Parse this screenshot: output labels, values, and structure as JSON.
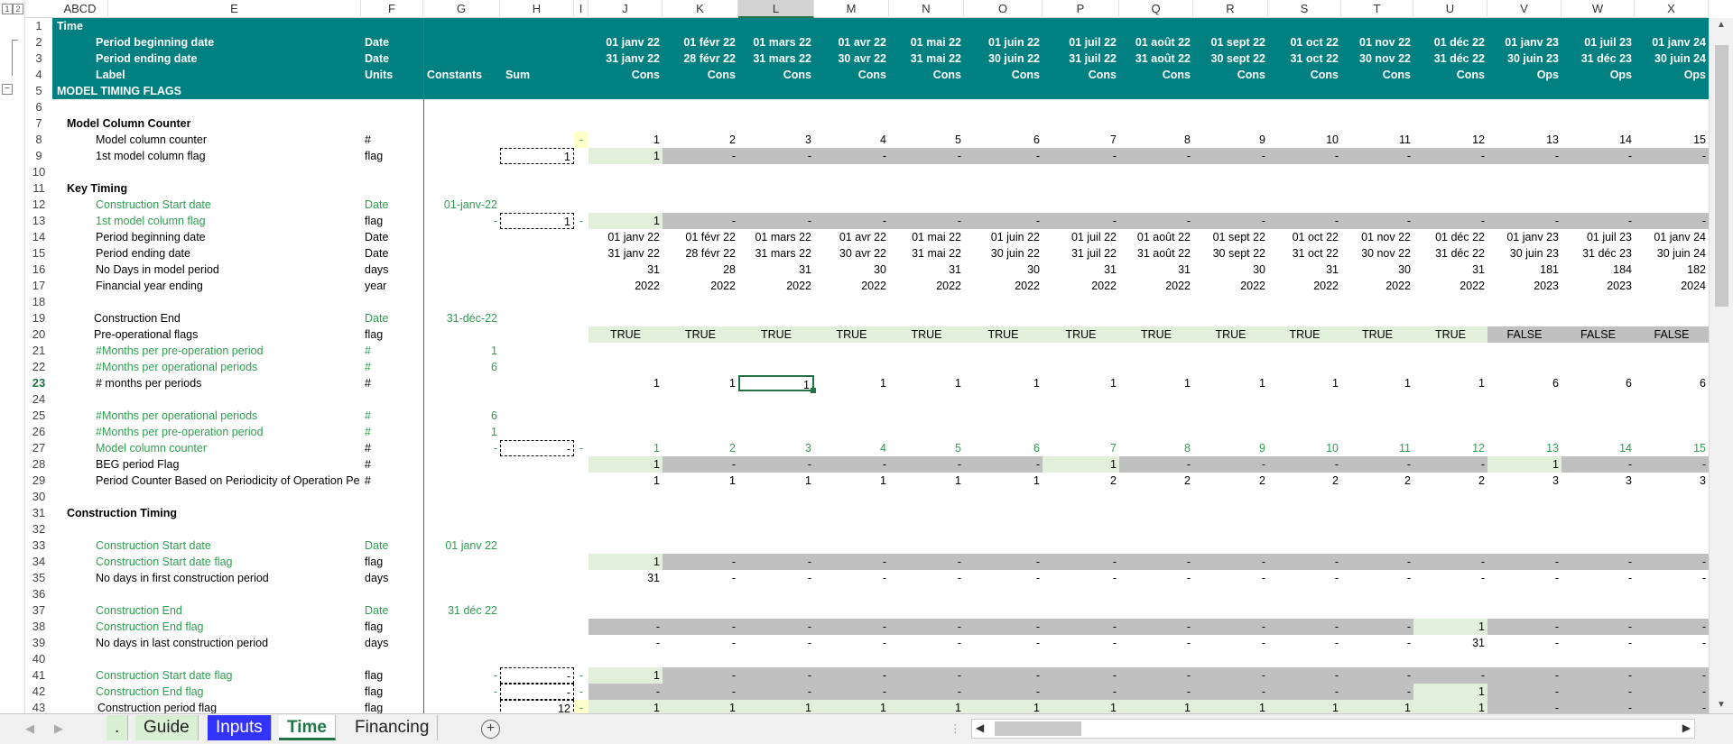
{
  "columns": [
    "ABCD",
    "E",
    "F",
    "G",
    "H",
    "I",
    "J",
    "K",
    "L",
    "M",
    "N",
    "O",
    "P",
    "Q",
    "R",
    "S",
    "T",
    "U",
    "V",
    "W",
    "X"
  ],
  "selected_column": "L",
  "outline_levels": [
    "1",
    "2"
  ],
  "header_rows": [
    {
      "row": "1",
      "label": "Time"
    },
    {
      "row": "2",
      "label": "Period beginning date",
      "unit": "Date",
      "dates": [
        "01 janv 22",
        "01 févr 22",
        "01 mars 22",
        "01 avr 22",
        "01 mai 22",
        "01 juin 22",
        "01 juil 22",
        "01 août 22",
        "01 sept 22",
        "01 oct 22",
        "01 nov 22",
        "01 déc 22",
        "01 janv 23",
        "01 juil 23",
        "01 janv 24"
      ]
    },
    {
      "row": "3",
      "label": "Period ending date",
      "unit": "Date",
      "dates": [
        "31 janv 22",
        "28 févr 22",
        "31 mars 22",
        "30 avr 22",
        "31 mai 22",
        "30 juin 22",
        "31 juil 22",
        "31 août 22",
        "30 sept 22",
        "31 oct 22",
        "30 nov 22",
        "31 déc 22",
        "30 juin 23",
        "31 déc 23",
        "30 juin 24"
      ]
    },
    {
      "row": "4",
      "label": "Label",
      "unit": "Units",
      "constants": "Constants",
      "sum": "Sum",
      "dates": [
        "Cons",
        "Cons",
        "Cons",
        "Cons",
        "Cons",
        "Cons",
        "Cons",
        "Cons",
        "Cons",
        "Cons",
        "Cons",
        "Cons",
        "Ops",
        "Ops",
        "Ops"
      ]
    }
  ],
  "rows": [
    {
      "row": "5",
      "label": "MODEL TIMING FLAGS"
    },
    {
      "row": "6"
    },
    {
      "row": "7",
      "label": "Model Column Counter"
    },
    {
      "row": "8",
      "label": "Model column counter",
      "unit": "#",
      "i": "-",
      "vals": [
        "1",
        "2",
        "3",
        "4",
        "5",
        "6",
        "7",
        "8",
        "9",
        "10",
        "11",
        "12",
        "13",
        "14",
        "15"
      ]
    },
    {
      "row": "9",
      "label": "1st model column flag",
      "unit": "flag",
      "sum": "1",
      "vals": [
        "1",
        "-",
        "-",
        "-",
        "-",
        "-",
        "-",
        "-",
        "-",
        "-",
        "-",
        "-",
        "-",
        "-",
        "-"
      ]
    },
    {
      "row": "10"
    },
    {
      "row": "11",
      "label": "Key Timing"
    },
    {
      "row": "12",
      "label": "Construction Start date",
      "unit": "Date",
      "const": "01-janv-22"
    },
    {
      "row": "13",
      "label": "1st model column flag",
      "unit": "flag",
      "const": "-",
      "sum": "1",
      "i": "-",
      "vals": [
        "1",
        "-",
        "-",
        "-",
        "-",
        "-",
        "-",
        "-",
        "-",
        "-",
        "-",
        "-",
        "-",
        "-",
        "-"
      ]
    },
    {
      "row": "14",
      "label": "Period beginning date",
      "unit": "Date",
      "vals": [
        "01 janv 22",
        "01 févr 22",
        "01 mars 22",
        "01 avr 22",
        "01 mai 22",
        "01 juin 22",
        "01 juil 22",
        "01 août 22",
        "01 sept 22",
        "01 oct 22",
        "01 nov 22",
        "01 déc 22",
        "01 janv 23",
        "01 juil 23",
        "01 janv 24"
      ]
    },
    {
      "row": "15",
      "label": "Period ending date",
      "unit": "Date",
      "vals": [
        "31 janv 22",
        "28 févr 22",
        "31 mars 22",
        "30 avr 22",
        "31 mai 22",
        "30 juin 22",
        "31 juil 22",
        "31 août 22",
        "30 sept 22",
        "31 oct 22",
        "30 nov 22",
        "31 déc 22",
        "30 juin 23",
        "31 déc 23",
        "30 juin 24"
      ]
    },
    {
      "row": "16",
      "label": "No Days in model period",
      "unit": "days",
      "vals": [
        "31",
        "28",
        "31",
        "30",
        "31",
        "30",
        "31",
        "31",
        "30",
        "31",
        "30",
        "31",
        "181",
        "184",
        "182"
      ]
    },
    {
      "row": "17",
      "label": "Financial year ending",
      "unit": "year",
      "vals": [
        "2022",
        "2022",
        "2022",
        "2022",
        "2022",
        "2022",
        "2022",
        "2022",
        "2022",
        "2022",
        "2022",
        "2022",
        "2023",
        "2023",
        "2024"
      ]
    },
    {
      "row": "18"
    },
    {
      "row": "19",
      "label": "Construction End",
      "unit": "Date",
      "const": "31-déc-22"
    },
    {
      "row": "20",
      "label": "Pre-operational flags",
      "unit": "flag",
      "vals": [
        "TRUE",
        "TRUE",
        "TRUE",
        "TRUE",
        "TRUE",
        "TRUE",
        "TRUE",
        "TRUE",
        "TRUE",
        "TRUE",
        "TRUE",
        "TRUE",
        "FALSE",
        "FALSE",
        "FALSE"
      ]
    },
    {
      "row": "21",
      "label": "#Months per pre-operation period",
      "unit": "#",
      "const": "1"
    },
    {
      "row": "22",
      "label": "#Months per operational periods",
      "unit": "#",
      "const": "6"
    },
    {
      "row": "23",
      "label": "# months per periods",
      "unit": "#",
      "vals": [
        "1",
        "1",
        "1",
        "1",
        "1",
        "1",
        "1",
        "1",
        "1",
        "1",
        "1",
        "1",
        "6",
        "6",
        "6"
      ]
    },
    {
      "row": "24"
    },
    {
      "row": "25",
      "label": "#Months per operational periods",
      "unit": "#",
      "const": "6"
    },
    {
      "row": "26",
      "label": "#Months per pre-operation period",
      "unit": "#",
      "const": "1"
    },
    {
      "row": "27",
      "label": "Model column counter",
      "unit": "#",
      "const": "-",
      "sum": "-",
      "i": "-",
      "vals": [
        "1",
        "2",
        "3",
        "4",
        "5",
        "6",
        "7",
        "8",
        "9",
        "10",
        "11",
        "12",
        "13",
        "14",
        "15"
      ]
    },
    {
      "row": "28",
      "label": "BEG period Flag",
      "unit": "#",
      "vals": [
        "1",
        "-",
        "-",
        "-",
        "-",
        "-",
        "1",
        "-",
        "-",
        "-",
        "-",
        "-",
        "1",
        "-",
        "-"
      ]
    },
    {
      "row": "29",
      "label": "Period Counter Based on Periodicity of Operation Pe",
      "unit": "#",
      "vals": [
        "1",
        "1",
        "1",
        "1",
        "1",
        "1",
        "2",
        "2",
        "2",
        "2",
        "2",
        "2",
        "3",
        "3",
        "3"
      ]
    },
    {
      "row": "30"
    },
    {
      "row": "31",
      "label": "Construction Timing"
    },
    {
      "row": "32"
    },
    {
      "row": "33",
      "label": "Construction Start date",
      "unit": "Date",
      "const": "01 janv 22"
    },
    {
      "row": "34",
      "label": "Construction Start date flag",
      "unit": "flag",
      "vals": [
        "1",
        "-",
        "-",
        "-",
        "-",
        "-",
        "-",
        "-",
        "-",
        "-",
        "-",
        "-",
        "-",
        "-",
        "-"
      ]
    },
    {
      "row": "35",
      "label": "No days in first construction period",
      "unit": "days",
      "vals": [
        "31",
        "-",
        "-",
        "-",
        "-",
        "-",
        "-",
        "-",
        "-",
        "-",
        "-",
        "-",
        "-",
        "-",
        "-"
      ]
    },
    {
      "row": "36"
    },
    {
      "row": "37",
      "label": "Construction End",
      "unit": "Date",
      "const": "31 déc 22"
    },
    {
      "row": "38",
      "label": "Construction End flag",
      "unit": "flag",
      "vals": [
        "-",
        "-",
        "-",
        "-",
        "-",
        "-",
        "-",
        "-",
        "-",
        "-",
        "-",
        "1",
        "-",
        "-",
        "-"
      ]
    },
    {
      "row": "39",
      "label": "No days in last construction period",
      "unit": "days",
      "vals": [
        "-",
        "-",
        "-",
        "-",
        "-",
        "-",
        "-",
        "-",
        "-",
        "-",
        "-",
        "31",
        "-",
        "-",
        "-"
      ]
    },
    {
      "row": "40"
    },
    {
      "row": "41",
      "label": "Construction Start date flag",
      "unit": "flag",
      "const": "-",
      "sum": "-",
      "i": "-",
      "vals": [
        "1",
        "-",
        "-",
        "-",
        "-",
        "-",
        "-",
        "-",
        "-",
        "-",
        "-",
        "-",
        "-",
        "-",
        "-"
      ]
    },
    {
      "row": "42",
      "label": "Construction End flag",
      "unit": "flag",
      "const": "-",
      "sum": "-",
      "i": "-",
      "vals": [
        "-",
        "-",
        "-",
        "-",
        "-",
        "-",
        "-",
        "-",
        "-",
        "-",
        "-",
        "1",
        "-",
        "-",
        "-"
      ]
    },
    {
      "row": "43",
      "label": "Construction period flag",
      "unit": "flag",
      "sum": "12",
      "i": "-",
      "vals": [
        "1",
        "1",
        "1",
        "1",
        "1",
        "1",
        "1",
        "1",
        "1",
        "1",
        "1",
        "1",
        "-",
        "-",
        "-"
      ]
    }
  ],
  "sheet_tabs": [
    ".",
    "Guide",
    "Inputs",
    "Time",
    "Financing"
  ],
  "active_tab": "Time",
  "add_sheet": "+",
  "scroll_symbols": {
    "up": "▲",
    "down": "▼",
    "left": "◀",
    "right": "▶",
    "more": "⋮"
  }
}
